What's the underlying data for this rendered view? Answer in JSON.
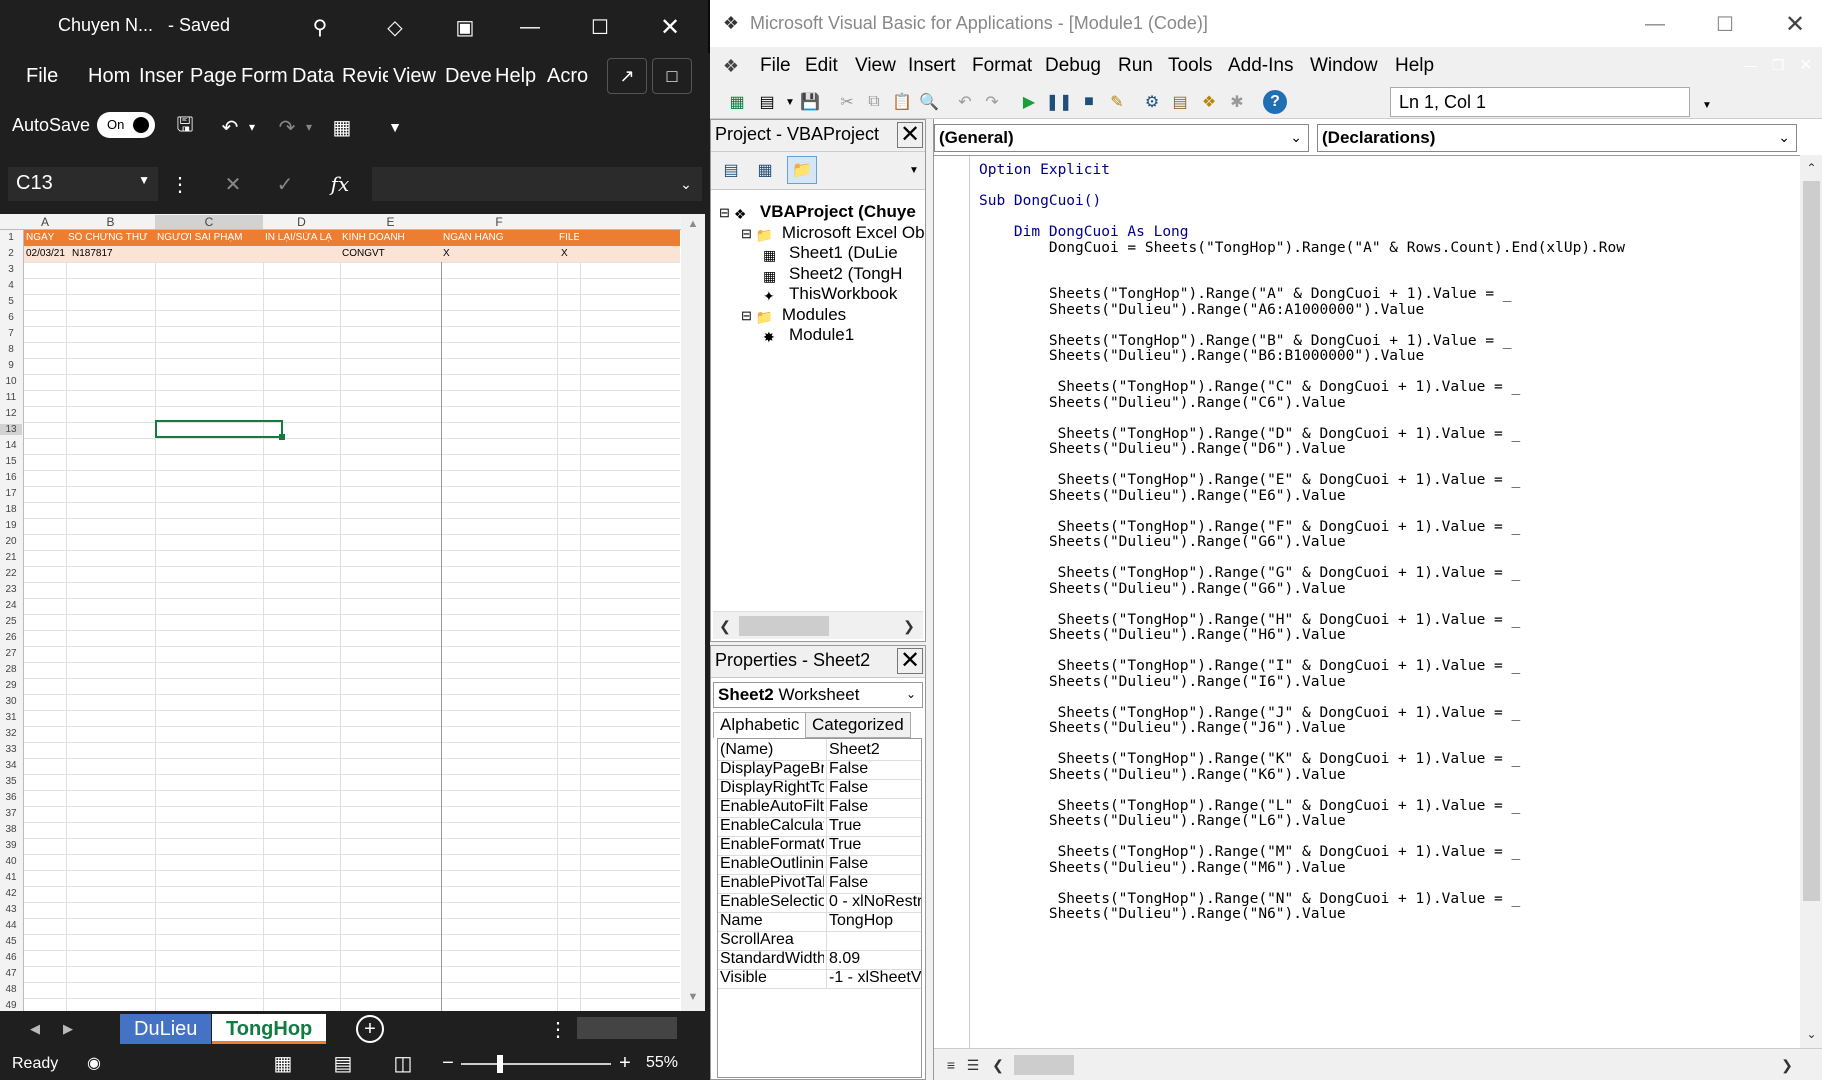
{
  "excel": {
    "title": "Chuyen N...",
    "saved_label": "- Saved",
    "ribbon_tabs": [
      "File",
      "Hom",
      "Inser",
      "Page",
      "Form",
      "Data",
      "Revie",
      "View",
      "Deve",
      "Help",
      "Acro"
    ],
    "autosave_label": "AutoSave",
    "autosave_state": "On",
    "name_box": "C13",
    "fx_symbol": "fx",
    "columns": [
      "A",
      "B",
      "C",
      "D",
      "E",
      "F"
    ],
    "rows": [
      "1",
      "2",
      "3",
      "4",
      "5",
      "6",
      "7",
      "8",
      "9",
      "10",
      "11",
      "12",
      "13",
      "14",
      "15",
      "16",
      "17",
      "18",
      "19",
      "20",
      "21",
      "22",
      "23",
      "24",
      "25",
      "26",
      "27",
      "28",
      "29",
      "30",
      "31",
      "32",
      "33",
      "34",
      "35",
      "36",
      "37",
      "38",
      "39",
      "40",
      "41",
      "42",
      "43",
      "44",
      "45",
      "46",
      "47",
      "48",
      "49"
    ],
    "headers": [
      "NGÀY",
      "SỐ CHỨNG THƯ",
      "NGƯỜI SAI PHẠM",
      "IN LẠI/SỬA LẠ",
      "KINH DOANH",
      "NGÂN HÀNG",
      "FILE S"
    ],
    "data_row": [
      "02/03/21",
      "N187817",
      "",
      "",
      "CONGVT",
      "X",
      "X"
    ],
    "sheets": [
      {
        "name": "DuLieu",
        "active": false
      },
      {
        "name": "TongHop",
        "active": true
      }
    ],
    "status_ready": "Ready",
    "zoom": "55%",
    "colors": {
      "header_orange": "#ed7d31",
      "data_row": "#fbe4d5",
      "active_tab_text": "#107c41",
      "inactive_tab_bg": "#4472c4"
    }
  },
  "vba": {
    "title": "Microsoft Visual Basic for Applications - [Module1 (Code)]",
    "menu": [
      "File",
      "Edit",
      "View",
      "Insert",
      "Format",
      "Debug",
      "Run",
      "Tools",
      "Add-Ins",
      "Window",
      "Help"
    ],
    "position": "Ln 1, Col 1",
    "project_title": "Project - VBAProject",
    "tree": [
      {
        "label": "VBAProject (Chuye",
        "level": 0,
        "bold": true,
        "icon": "vbaproject-icon"
      },
      {
        "label": "Microsoft Excel Ob",
        "level": 1,
        "bold": false,
        "icon": "folder-icon"
      },
      {
        "label": "Sheet1 (DuLie",
        "level": 2,
        "bold": false,
        "icon": "sheet-icon"
      },
      {
        "label": "Sheet2 (TongH",
        "level": 2,
        "bold": false,
        "icon": "sheet-icon"
      },
      {
        "label": "ThisWorkbook",
        "level": 2,
        "bold": false,
        "icon": "workbook-icon"
      },
      {
        "label": "Modules",
        "level": 1,
        "bold": false,
        "icon": "folder-icon"
      },
      {
        "label": "Module1",
        "level": 2,
        "bold": false,
        "icon": "module-icon"
      }
    ],
    "properties_title": "Properties - Sheet2",
    "properties_object_name": "Sheet2",
    "properties_object_type": "Worksheet",
    "properties_tabs": [
      "Alphabetic",
      "Categorized"
    ],
    "properties": [
      {
        "name": "(Name)",
        "value": "Sheet2"
      },
      {
        "name": "DisplayPageBr",
        "value": "False"
      },
      {
        "name": "DisplayRightTo",
        "value": "False"
      },
      {
        "name": "EnableAutoFilt",
        "value": "False"
      },
      {
        "name": "EnableCalculat",
        "value": "True"
      },
      {
        "name": "EnableFormatC",
        "value": "True"
      },
      {
        "name": "EnableOutlinin",
        "value": "False"
      },
      {
        "name": "EnablePivotTal",
        "value": "False"
      },
      {
        "name": "EnableSelectio",
        "value": "0 - xlNoRestri"
      },
      {
        "name": "Name",
        "value": "TongHop"
      },
      {
        "name": "ScrollArea",
        "value": ""
      },
      {
        "name": "StandardWidth",
        "value": "8.09"
      },
      {
        "name": "Visible",
        "value": "-1 - xlSheetVi"
      }
    ],
    "object_combo": "(General)",
    "procedure_combo": "(Declarations)",
    "code": [
      "Option Explicit",
      "",
      "Sub DongCuoi()",
      "",
      "    Dim DongCuoi As Long",
      "        DongCuoi = Sheets(\"TongHop\").Range(\"A\" & Rows.Count).End(xlUp).Row",
      "",
      "",
      "        Sheets(\"TongHop\").Range(\"A\" & DongCuoi + 1).Value = _",
      "        Sheets(\"Dulieu\").Range(\"A6:A1000000\").Value",
      "",
      "        Sheets(\"TongHop\").Range(\"B\" & DongCuoi + 1).Value = _",
      "        Sheets(\"Dulieu\").Range(\"B6:B1000000\").Value",
      "",
      "         Sheets(\"TongHop\").Range(\"C\" & DongCuoi + 1).Value = _",
      "        Sheets(\"Dulieu\").Range(\"C6\").Value",
      "",
      "         Sheets(\"TongHop\").Range(\"D\" & DongCuoi + 1).Value = _",
      "        Sheets(\"Dulieu\").Range(\"D6\").Value",
      "",
      "         Sheets(\"TongHop\").Range(\"E\" & DongCuoi + 1).Value = _",
      "        Sheets(\"Dulieu\").Range(\"E6\").Value",
      "",
      "         Sheets(\"TongHop\").Range(\"F\" & DongCuoi + 1).Value = _",
      "        Sheets(\"Dulieu\").Range(\"G6\").Value",
      "",
      "         Sheets(\"TongHop\").Range(\"G\" & DongCuoi + 1).Value = _",
      "        Sheets(\"Dulieu\").Range(\"G6\").Value",
      "",
      "         Sheets(\"TongHop\").Range(\"H\" & DongCuoi + 1).Value = _",
      "        Sheets(\"Dulieu\").Range(\"H6\").Value",
      "",
      "         Sheets(\"TongHop\").Range(\"I\" & DongCuoi + 1).Value = _",
      "        Sheets(\"Dulieu\").Range(\"I6\").Value",
      "",
      "         Sheets(\"TongHop\").Range(\"J\" & DongCuoi + 1).Value = _",
      "        Sheets(\"Dulieu\").Range(\"J6\").Value",
      "",
      "         Sheets(\"TongHop\").Range(\"K\" & DongCuoi + 1).Value = _",
      "        Sheets(\"Dulieu\").Range(\"K6\").Value",
      "",
      "         Sheets(\"TongHop\").Range(\"L\" & DongCuoi + 1).Value = _",
      "        Sheets(\"Dulieu\").Range(\"L6\").Value",
      "",
      "         Sheets(\"TongHop\").Range(\"M\" & DongCuoi + 1).Value = _",
      "        Sheets(\"Dulieu\").Range(\"M6\").Value",
      "",
      "         Sheets(\"TongHop\").Range(\"N\" & DongCuoi + 1).Value = _",
      "        Sheets(\"Dulieu\").Range(\"N6\").Value"
    ]
  }
}
